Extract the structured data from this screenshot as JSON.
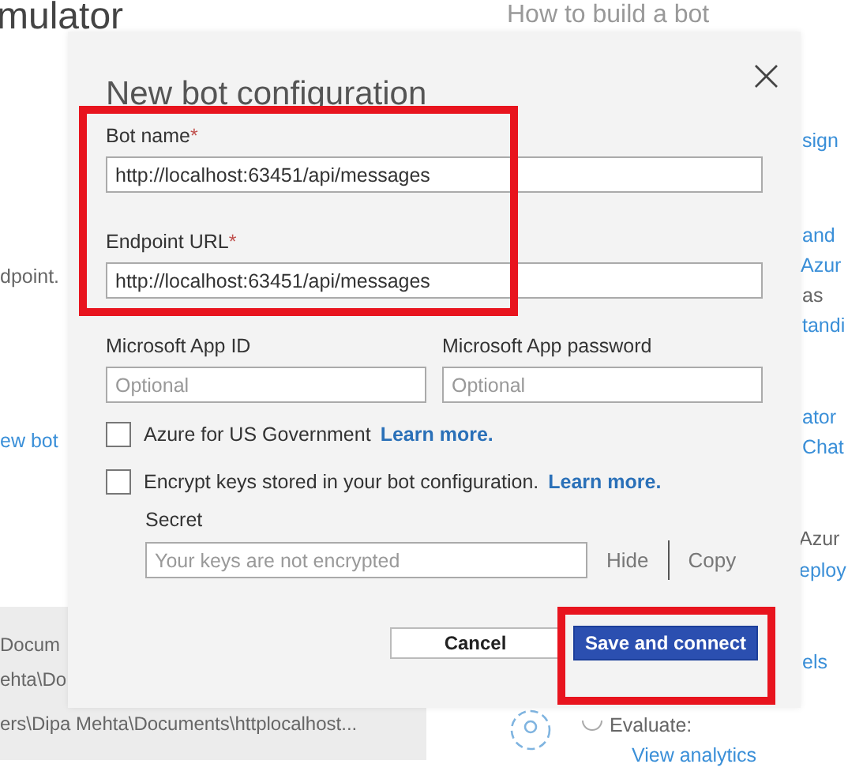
{
  "background": {
    "title": "mulator",
    "heading": "How to build a bot",
    "texts": [
      {
        "text": "dpoint.",
        "kind": "text"
      },
      {
        "text": "ew bot",
        "kind": "link"
      },
      {
        "text": "sign",
        "kind": "link"
      },
      {
        "text": "and",
        "kind": "link"
      },
      {
        "text": "Azur",
        "kind": "link"
      },
      {
        "text": "as",
        "kind": "text"
      },
      {
        "text": "tandi",
        "kind": "link"
      },
      {
        "text": "ator",
        "kind": "link"
      },
      {
        "text": "Chat",
        "kind": "link"
      },
      {
        "text": "Azur",
        "kind": "text"
      },
      {
        "text": "eploy",
        "kind": "link"
      },
      {
        "text": "els",
        "kind": "link"
      },
      {
        "text": "Evaluate:",
        "kind": "text"
      },
      {
        "text": "View analytics",
        "kind": "link"
      }
    ],
    "recent_files": [
      "Docum",
      "ehta\\Do",
      "ers\\Dipa Mehta\\Documents\\httplocalhost..."
    ]
  },
  "dialog": {
    "title": "New bot configuration",
    "close": "×",
    "bot_name": {
      "label": "Bot name",
      "required_mark": "*",
      "value": "http://localhost:63451/api/messages"
    },
    "endpoint_url": {
      "label": "Endpoint URL",
      "required_mark": "*",
      "value": "http://localhost:63451/api/messages"
    },
    "app_id": {
      "label": "Microsoft App ID",
      "placeholder": "Optional"
    },
    "app_password": {
      "label": "Microsoft App password",
      "placeholder": "Optional"
    },
    "checkboxes": [
      {
        "label": "Azure for US Government",
        "link": "Learn more.",
        "checked": false
      },
      {
        "label": "Encrypt keys stored in your bot configuration.",
        "link": "Learn more.",
        "checked": false
      }
    ],
    "secret": {
      "label": "Secret",
      "placeholder": "Your keys are not encrypted",
      "actions": [
        "Hide",
        "Copy"
      ]
    },
    "buttons": [
      {
        "label": "Cancel",
        "kind": "secondary"
      },
      {
        "label": "Save and connect",
        "kind": "primary"
      }
    ]
  }
}
